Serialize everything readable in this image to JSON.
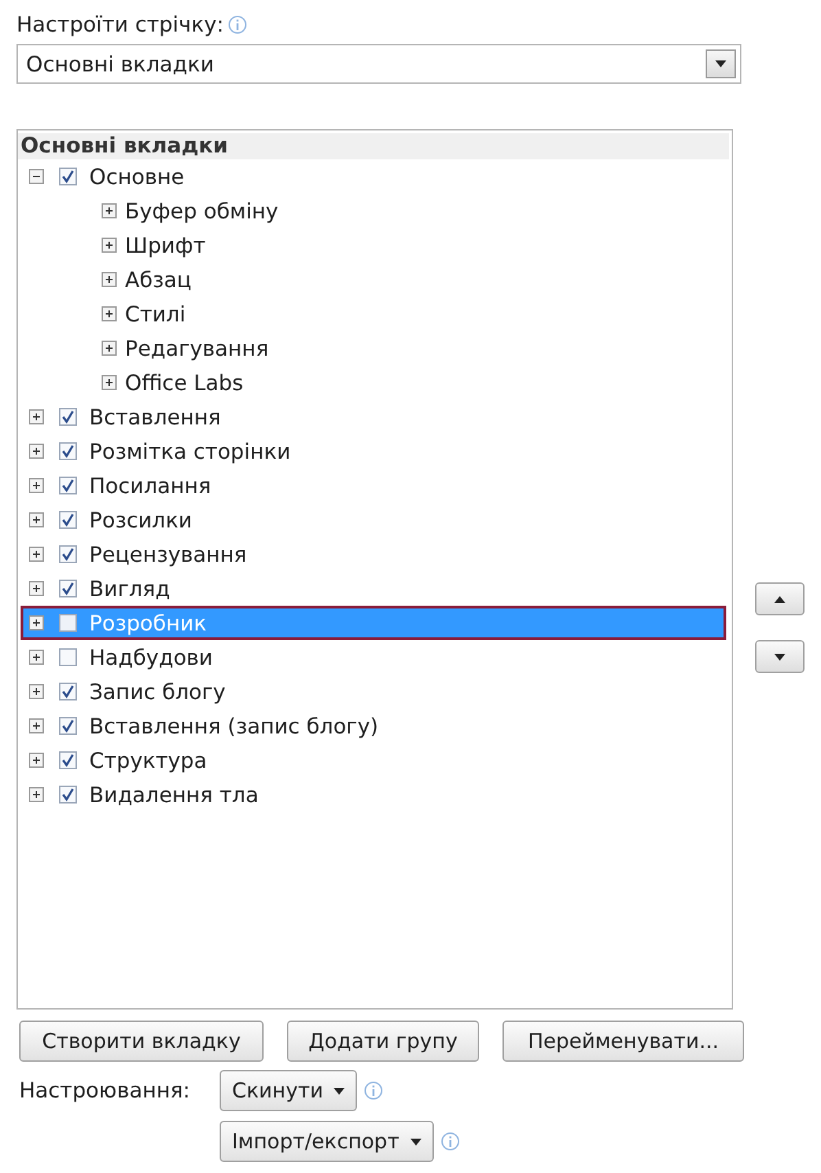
{
  "customize": {
    "label": "Настроїти стрічку:",
    "info": true
  },
  "dropdown": {
    "value": "Основні вкладки"
  },
  "tree": {
    "header": "Основні вкладки",
    "items": [
      {
        "label": "Основне",
        "checked": true,
        "expanded": true,
        "selected": false,
        "children": [
          {
            "label": "Буфер обміну",
            "expanded": false
          },
          {
            "label": "Шрифт",
            "expanded": false
          },
          {
            "label": "Абзац",
            "expanded": false
          },
          {
            "label": "Стилі",
            "expanded": false
          },
          {
            "label": "Редагування",
            "expanded": false
          },
          {
            "label": "Office Labs",
            "expanded": false
          }
        ]
      },
      {
        "label": "Вставлення",
        "checked": true,
        "expanded": false,
        "selected": false
      },
      {
        "label": "Розмітка сторінки",
        "checked": true,
        "expanded": false,
        "selected": false
      },
      {
        "label": "Посилання",
        "checked": true,
        "expanded": false,
        "selected": false
      },
      {
        "label": "Розсилки",
        "checked": true,
        "expanded": false,
        "selected": false
      },
      {
        "label": "Рецензування",
        "checked": true,
        "expanded": false,
        "selected": false
      },
      {
        "label": "Вигляд",
        "checked": true,
        "expanded": false,
        "selected": false
      },
      {
        "label": "Розробник",
        "checked": false,
        "expanded": false,
        "selected": true
      },
      {
        "label": "Надбудови",
        "checked": false,
        "expanded": false,
        "selected": false
      },
      {
        "label": "Запис блогу",
        "checked": true,
        "expanded": false,
        "selected": false
      },
      {
        "label": "Вставлення (запис блогу)",
        "checked": true,
        "expanded": false,
        "selected": false
      },
      {
        "label": "Структура",
        "checked": true,
        "expanded": false,
        "selected": false
      },
      {
        "label": "Видалення тла",
        "checked": true,
        "expanded": false,
        "selected": false
      }
    ]
  },
  "tree_buttons": [
    "Створити вкладку",
    "Додати групу",
    "Перейменувати..."
  ],
  "customizations": {
    "label": "Настроювання:",
    "buttons": [
      {
        "label": "Скинути",
        "info": true
      },
      {
        "label": "Імпорт/експорт",
        "info": true
      }
    ]
  }
}
